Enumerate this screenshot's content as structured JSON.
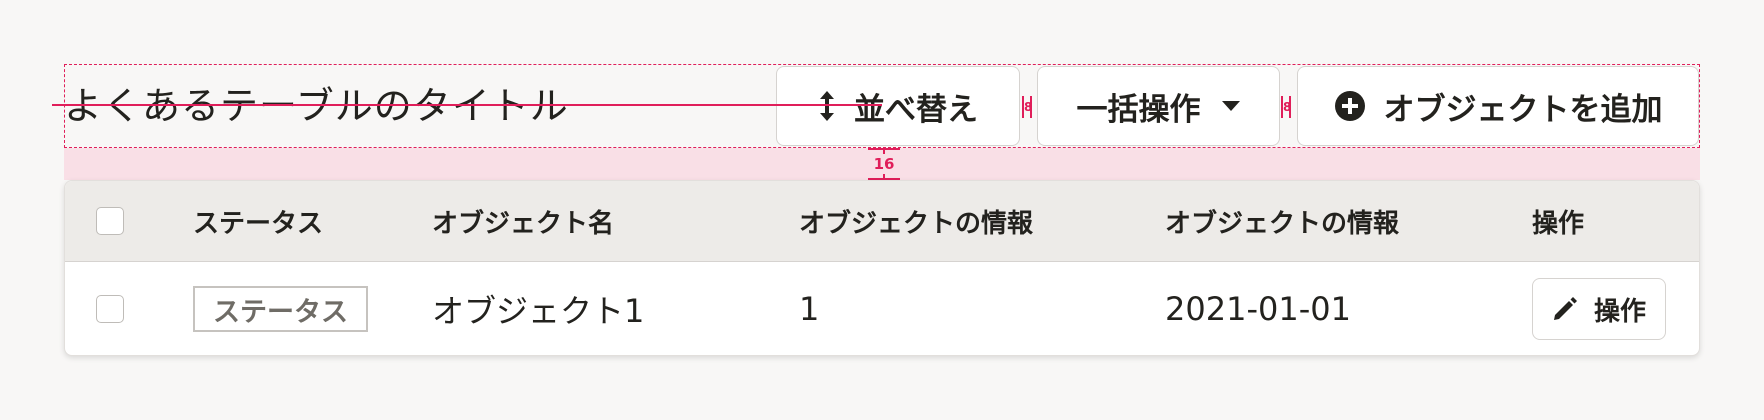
{
  "header": {
    "title": "よくあるテーブルのタイトル",
    "sort_button": "並べ替え",
    "bulk_button": "一括操作",
    "add_button": "オブジェクトを追加",
    "spacing_gap_label": "8",
    "spacing_vertical_label": "16"
  },
  "icons": {
    "sort": "up-down-arrow-icon",
    "bulk": "caret-down-icon",
    "add": "plus-circle-icon",
    "edit": "pencil-icon"
  },
  "colors": {
    "guide": "#e01e5a",
    "guide_fill": "#f9dfe6",
    "header_bg": "#edebe8"
  },
  "table": {
    "columns": [
      "ステータス",
      "オブジェクト名",
      "オブジェクトの情報",
      "オブジェクトの情報",
      "操作"
    ],
    "rows": [
      {
        "status": "ステータス",
        "name": "オブジェクト1",
        "info1": "1",
        "info2": "2021-01-01",
        "action": "操作"
      }
    ]
  }
}
